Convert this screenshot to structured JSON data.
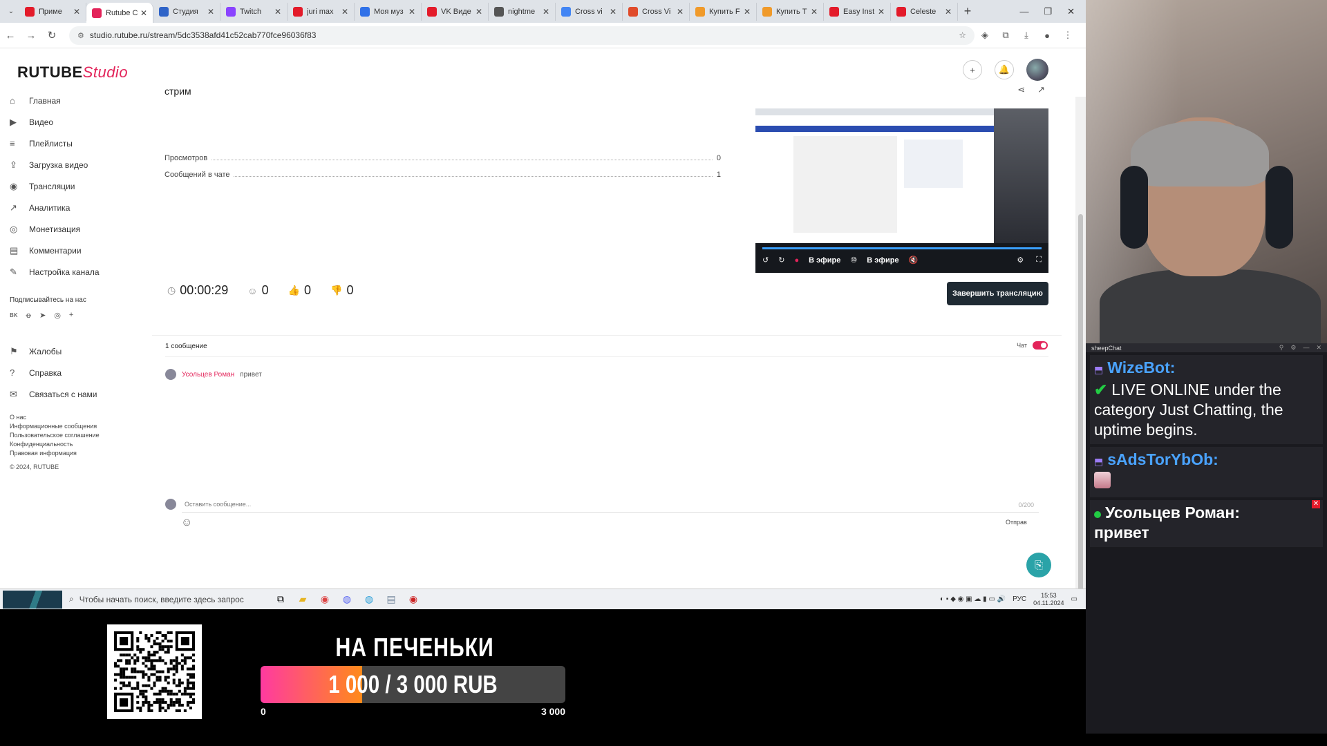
{
  "browser": {
    "tabs": [
      {
        "label": "Приме",
        "color": "#e31b2a"
      },
      {
        "label": "Rutube C",
        "color": "#e3245a"
      },
      {
        "label": "Студия",
        "color": "#2f64c8"
      },
      {
        "label": "Twitch",
        "color": "#8a43ff"
      },
      {
        "label": "juri max",
        "color": "#e31b2a"
      },
      {
        "label": "Моя муз",
        "color": "#3071e8"
      },
      {
        "label": "VK Виде",
        "color": "#e31b2a"
      },
      {
        "label": "nightme",
        "color": "#555555"
      },
      {
        "label": "Cross vi",
        "color": "#4285f4"
      },
      {
        "label": "Cross Vi",
        "color": "#e04b2a"
      },
      {
        "label": "Купить F",
        "color": "#f09a2a"
      },
      {
        "label": "Купить T",
        "color": "#f09a2a"
      },
      {
        "label": "Easy Inst",
        "color": "#e31b2a"
      },
      {
        "label": "Celeste",
        "color": "#e31b2a"
      }
    ],
    "active_tab_index": 1,
    "new_tab_label": "+",
    "tab_close_glyph": "✕",
    "url": "studio.rutube.ru/stream/5dc3538afd41c52cab770fce96036f83"
  },
  "app": {
    "logo_main": "RUTUBE",
    "logo_sub": "Studio"
  },
  "sidebar": {
    "items": [
      {
        "label": "Главная",
        "icon": "home-icon"
      },
      {
        "label": "Видео",
        "icon": "video-icon"
      },
      {
        "label": "Плейлисты",
        "icon": "playlist-icon"
      },
      {
        "label": "Загрузка видео",
        "icon": "upload-icon"
      },
      {
        "label": "Трансляции",
        "icon": "broadcast-icon"
      },
      {
        "label": "Аналитика",
        "icon": "analytics-icon"
      },
      {
        "label": "Монетизация",
        "icon": "monetization-icon"
      },
      {
        "label": "Комментарии",
        "icon": "comments-icon"
      },
      {
        "label": "Настройка канала",
        "icon": "settings-wand-icon"
      }
    ],
    "subscribe_label": "Подписывайтесь на нас",
    "socials": [
      "vk",
      "ok",
      "telegram",
      "viber",
      "+"
    ],
    "support_items": [
      {
        "label": "Жалобы",
        "icon": "flag-icon"
      },
      {
        "label": "Справка",
        "icon": "help-icon"
      },
      {
        "label": "Связаться с нами",
        "icon": "contact-icon"
      }
    ],
    "footer_links": [
      "О нас",
      "Информационные сообщения",
      "Пользовательское соглашение",
      "Конфиденциальность",
      "Правовая информация"
    ],
    "copyright": "© 2024, RUTUBE"
  },
  "stream": {
    "title": "стрим",
    "stats": [
      {
        "label": "Просмотров",
        "value": "0"
      },
      {
        "label": "Сообщений в чате",
        "value": "1"
      }
    ],
    "duration": "00:00:29",
    "viewers": "0",
    "likes": "0",
    "dislikes": "0",
    "end_button": "Завершить трансляцию",
    "player": {
      "live_label_1": "В эфире",
      "live_label_2": "В эфире",
      "progress": 1.0,
      "accent": "#3aa0ff"
    }
  },
  "chat": {
    "count_label": "1 сообщение",
    "toggle_label": "Чат",
    "toggle_on": true,
    "messages": [
      {
        "author": "Усольцев Роман",
        "text": "привет"
      }
    ],
    "input_placeholder": "Оставить сообщение...",
    "counter": "0/200",
    "send_label": "Отправ"
  },
  "taskbar": {
    "search_placeholder": "Чтобы начать поиск, введите здесь запрос",
    "lang": "РУС",
    "time": "15:53",
    "date": "04.11.2024"
  },
  "overlay": {
    "goal_title": "НА ПЕЧЕНЬКИ",
    "goal_text": "1 000 / 3 000 RUB",
    "goal_current": 1000,
    "goal_target": 3000,
    "goal_min_label": "0",
    "goal_max_label": "3 000"
  },
  "sheepchat": {
    "title": "sheepChat",
    "messages": [
      {
        "author": "WizeBot:",
        "author_color": "#4aa3ff",
        "check": true,
        "text": "LIVE ONLINE under the category Just Chatting, the uptime begins."
      },
      {
        "author": "sAdsTorYbOb:",
        "author_color": "#4aa3ff",
        "sticker": true
      },
      {
        "author": "Усольцев Роман:",
        "author_color": "#ffffff",
        "text": "привет",
        "dot": true
      }
    ]
  }
}
